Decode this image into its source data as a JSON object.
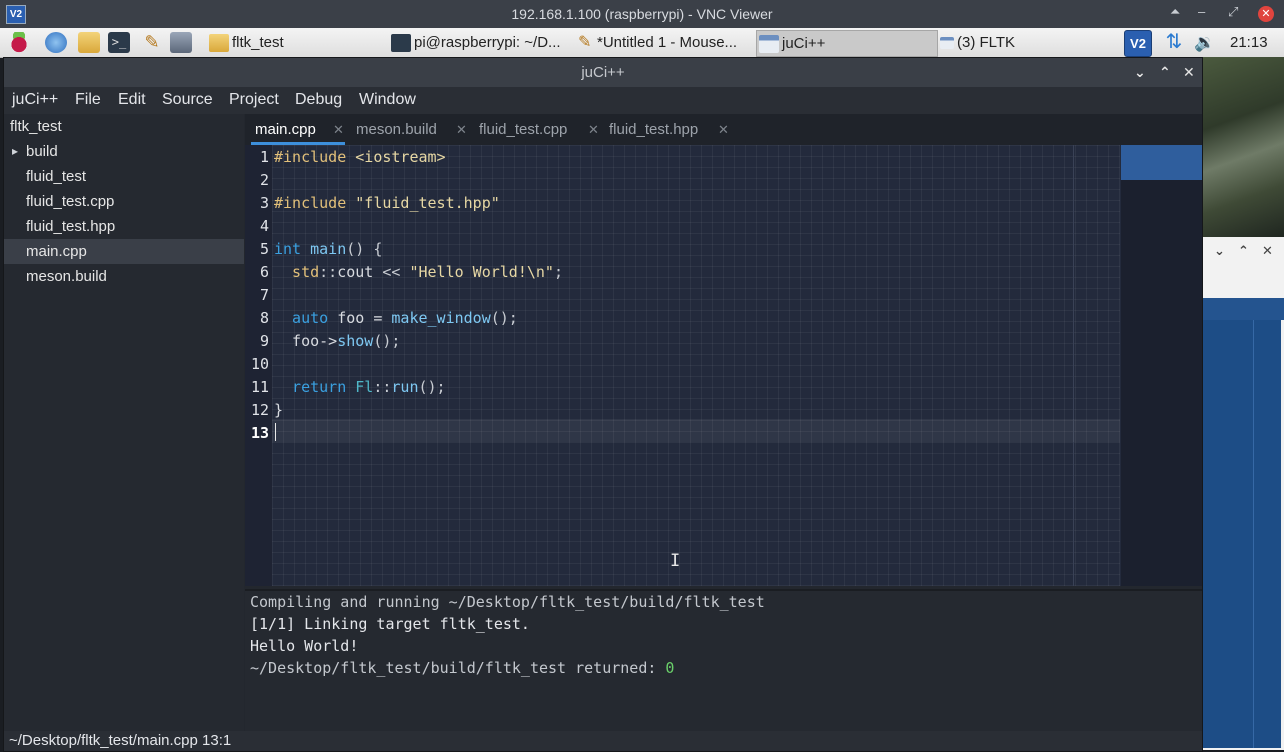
{
  "vnc": {
    "title": "192.168.1.100 (raspberrypi) - VNC Viewer",
    "logo_label": "V2",
    "controls": [
      "⏶",
      "–",
      "⤢"
    ],
    "close": "✕"
  },
  "taskbar": {
    "launchers": [
      "raspberry-menu-icon",
      "web-browser-icon",
      "file-manager-icon",
      "terminal-icon",
      "text-editor-icon",
      "archive-icon"
    ],
    "tasks": [
      {
        "label": "fltk_test",
        "icon": "folder-icon"
      },
      {
        "label": "pi@raspberrypi: ~/D...",
        "icon": "terminal-icon"
      },
      {
        "label": "*Untitled 1 - Mouse...",
        "icon": "pencil-icon"
      },
      {
        "label": "juCi++",
        "icon": "window-icon"
      },
      {
        "label": "(3) FLTK",
        "icon": "window-icon"
      }
    ],
    "tray": {
      "vnc_label": "V2",
      "network_icon": "transfer-arrows-icon",
      "volume_icon": "speaker-icon"
    },
    "clock": "21:13"
  },
  "window": {
    "title": "juCi++",
    "controls": [
      "⌄",
      "⌃",
      "✕"
    ]
  },
  "menubar": [
    "juCi++",
    "File",
    "Edit",
    "Source",
    "Project",
    "Debug",
    "Window"
  ],
  "sidebar": {
    "root": "fltk_test",
    "items": [
      {
        "label": "build",
        "expander": "▸"
      },
      {
        "label": "fluid_test"
      },
      {
        "label": "fluid_test.cpp"
      },
      {
        "label": "fluid_test.hpp"
      },
      {
        "label": "main.cpp",
        "selected": true
      },
      {
        "label": "meson.build"
      }
    ]
  },
  "tabs": [
    {
      "label": "main.cpp",
      "active": true,
      "close": "✕"
    },
    {
      "label": "meson.build",
      "close": "✕"
    },
    {
      "label": "fluid_test.cpp",
      "close": "✕"
    },
    {
      "label": "fluid_test.hpp",
      "close": "✕"
    }
  ],
  "editor": {
    "line_numbers": [
      "1",
      "2",
      "3",
      "4",
      "5",
      "6",
      "7",
      "8",
      "9",
      "10",
      "11",
      "12",
      "13"
    ],
    "current_line": "13",
    "code": {
      "l1_directive": "#include",
      "l1_header": " <iostream>",
      "l3_directive": "#include",
      "l3_header": " \"fluid_test.hpp\"",
      "l5_type": "int",
      "l5_fn": " main",
      "l5_rest": "() {",
      "l6_ns": "  std",
      "l6_sep": "::",
      "l6_cout": "cout",
      "l6_op": " << ",
      "l6_str": "\"Hello World!\\n\"",
      "l6_end": ";",
      "l8_kw": "  auto",
      "l8_var": " foo = ",
      "l8_fn": "make_window",
      "l8_end": "();",
      "l9_var": "  foo->",
      "l9_fn": "show",
      "l9_end": "();",
      "l11_kw": "  return",
      "l11_ns": " Fl",
      "l11_sep": "::",
      "l11_fn": "run",
      "l11_end": "();",
      "l12": "}"
    },
    "mouse_cursor": "I"
  },
  "terminal": {
    "lines": [
      "Compiling and running ~/Desktop/fltk_test/build/fltk_test",
      "[1/1] Linking target fltk_test.",
      "Hello World!"
    ],
    "return_prefix": "~/Desktop/fltk_test/build/fltk_test returned: ",
    "return_code": "0"
  },
  "statusbar": {
    "text": "~/Desktop/fltk_test/main.cpp 13:1"
  },
  "background_window": {
    "controls": [
      "⌄",
      "⌃",
      "✕"
    ]
  },
  "colors": {
    "accent_blue": "#3d8fdb",
    "keyword": "#3aa0e0",
    "preprocessor": "#e2c07a",
    "string": "#e6d7a4",
    "success_green": "#6ad06a"
  }
}
